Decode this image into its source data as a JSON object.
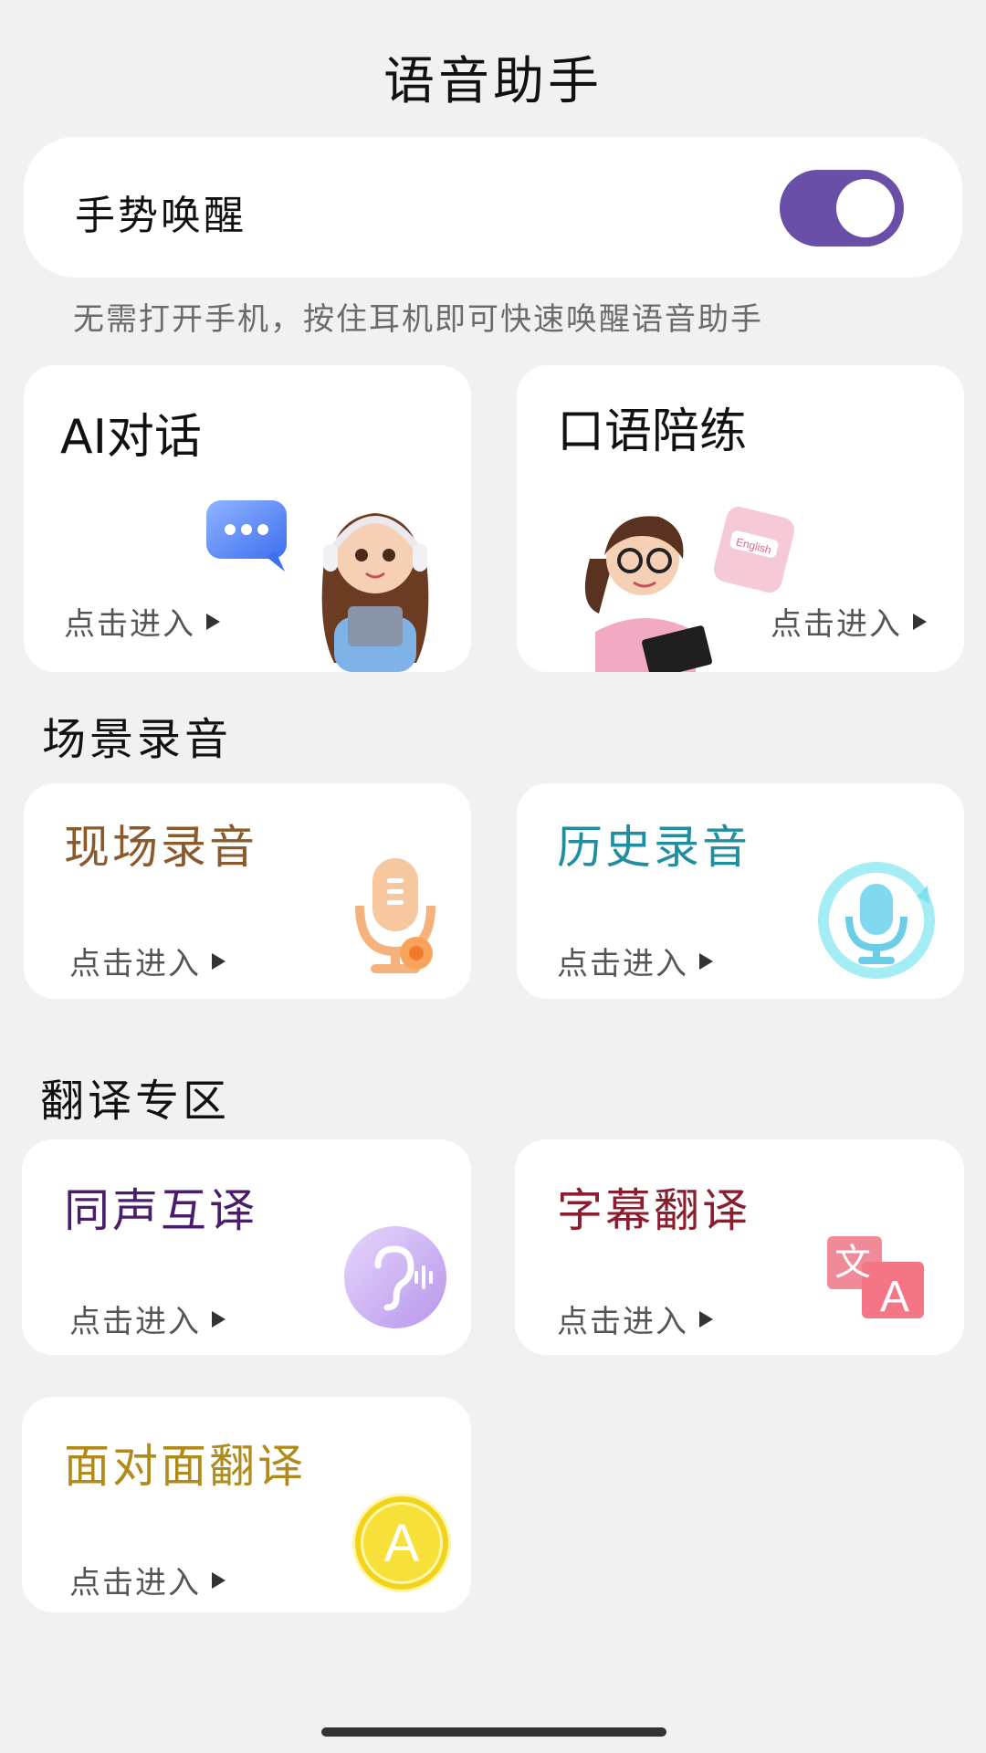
{
  "header": {
    "title": "语音助手"
  },
  "wake": {
    "label": "手势唤醒",
    "enabled": true,
    "hint": "无需打开手机，按住耳机即可快速唤醒语音助手"
  },
  "top_cards": [
    {
      "title": "AI对话",
      "enter": "点击进入"
    },
    {
      "title": "口语陪练",
      "enter": "点击进入",
      "book_text": "English"
    }
  ],
  "sections": {
    "recording": {
      "heading": "场景录音",
      "cards": [
        {
          "title": "现场录音",
          "enter": "点击进入",
          "color": "#8a5a2b"
        },
        {
          "title": "历史录音",
          "enter": "点击进入",
          "color": "#1f8fa0"
        }
      ]
    },
    "translation": {
      "heading": "翻译专区",
      "cards": [
        {
          "title": "同声互译",
          "enter": "点击进入",
          "color": "#4a1d6b"
        },
        {
          "title": "字幕翻译",
          "enter": "点击进入",
          "color": "#8a1d2e"
        },
        {
          "title": "面对面翻译",
          "enter": "点击进入",
          "color": "#b08a1a"
        }
      ]
    }
  },
  "icons": {
    "translate_glyph_zh": "文",
    "translate_glyph_en": "A",
    "face_glyph": "A"
  },
  "colors": {
    "toggle_on": "#6a4fa8",
    "background": "#f1f1f1"
  }
}
